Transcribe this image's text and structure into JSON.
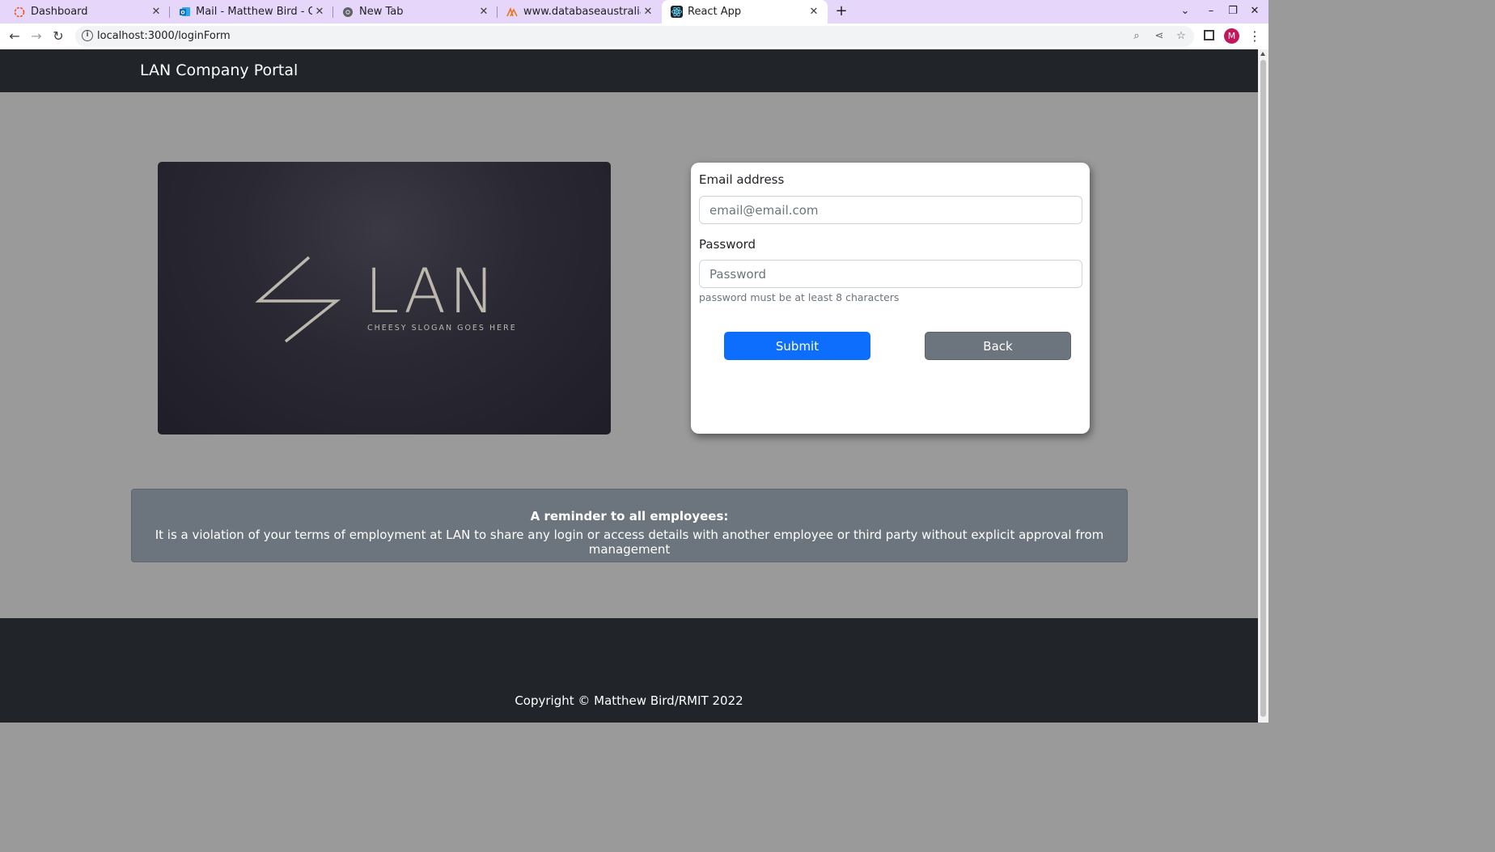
{
  "browser": {
    "tabs": [
      {
        "title": "Dashboard",
        "icon": "ubuntu-circle-icon",
        "active": false
      },
      {
        "title": "Mail - Matthew Bird - Outlook",
        "icon": "outlook-icon",
        "active": false
      },
      {
        "title": "New Tab",
        "icon": "chrome-icon",
        "active": false
      },
      {
        "title": "www.databaseaustralia.com",
        "icon": "database-australia-icon",
        "active": false
      },
      {
        "title": "React App",
        "icon": "react-icon",
        "active": true
      }
    ],
    "url": "localhost:3000/loginForm",
    "profile_initial": "M"
  },
  "navbar": {
    "brand": "LAN Company Portal"
  },
  "logo": {
    "wordmark": "LAN",
    "slogan": "CHEESY SLOGAN GOES HERE"
  },
  "login": {
    "email_label": "Email address",
    "email_placeholder": "email@email.com",
    "email_value": "",
    "password_label": "Password",
    "password_placeholder": "Password",
    "password_value": "",
    "password_hint": "password must be at least 8 characters",
    "submit_label": "Submit",
    "back_label": "Back"
  },
  "notice": {
    "heading": "A reminder to all employees:",
    "text": "It is a violation of your terms of employment at LAN to share any login or access details with another employee or third party without explicit approval from management"
  },
  "footer": {
    "copyright": "Copyright © Matthew Bird/RMIT 2022"
  },
  "colors": {
    "navbar": "#212529",
    "page_background": "#9a9a9a",
    "primary": "#0d6efd",
    "secondary": "#6c757d",
    "tab_strip": "#e6d7fa"
  }
}
